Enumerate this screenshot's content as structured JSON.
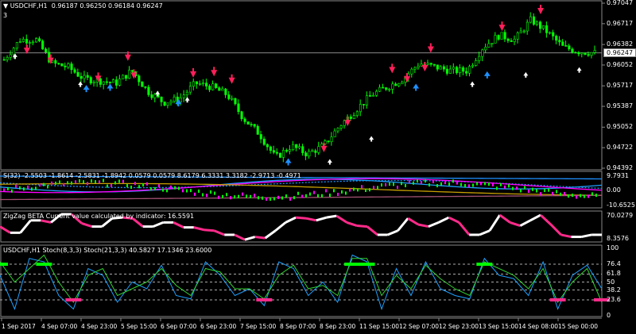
{
  "header": {
    "symbol": "USDCHF,H1",
    "ohlc": "0.96187 0.96250 0.96184 0.96247",
    "sub": "3"
  },
  "colors": {
    "bull": "#00ff00",
    "bear": "#00ff00",
    "up_arrow": "#ffffff",
    "buy_arrow": "#1e90ff",
    "sell_arrow": "#ff1f5a",
    "magenta": "#ff00ff",
    "cyan": "#1ea0ff",
    "zigzag_up": "#ffffff",
    "zigzag_down": "#ff2a8a"
  },
  "chart_data": [
    {
      "type": "candlestick",
      "title": "USDCHF,H1",
      "ylim": [
        0.94392,
        0.97047
      ],
      "y_ticks": [
        "0.97047",
        "0.96717",
        "0.96382",
        "0.96052",
        "0.95717",
        "0.95387",
        "0.95052",
        "0.94722",
        "0.94392"
      ],
      "current_price": "0.96247",
      "close_path": [
        0.9614,
        0.9646,
        0.9646,
        0.9608,
        0.9602,
        0.9583,
        0.958,
        0.9576,
        0.9596,
        0.9563,
        0.9545,
        0.9551,
        0.9576,
        0.957,
        0.9557,
        0.9519,
        0.9494,
        0.9456,
        0.9475,
        0.9462,
        0.9475,
        0.9507,
        0.9532,
        0.9557,
        0.957,
        0.9583,
        0.9608,
        0.9602,
        0.9596,
        0.9596,
        0.9634,
        0.9653,
        0.9646,
        0.9678,
        0.9659,
        0.9634,
        0.9627,
        0.96247
      ],
      "arrows": [
        {
          "i": 0.02,
          "p": 0.962,
          "kind": "up"
        },
        {
          "i": 0.04,
          "p": 0.9628,
          "kind": "sell"
        },
        {
          "i": 0.08,
          "p": 0.9612,
          "kind": "sell"
        },
        {
          "i": 0.14,
          "p": 0.9568,
          "kind": "buy"
        },
        {
          "i": 0.16,
          "p": 0.9583,
          "kind": "sell"
        },
        {
          "i": 0.13,
          "p": 0.9575,
          "kind": "up"
        },
        {
          "i": 0.18,
          "p": 0.957,
          "kind": "buy"
        },
        {
          "i": 0.21,
          "p": 0.9617,
          "kind": "sell"
        },
        {
          "i": 0.22,
          "p": 0.9588,
          "kind": "sell"
        },
        {
          "i": 0.26,
          "p": 0.956,
          "kind": "up"
        },
        {
          "i": 0.295,
          "p": 0.9545,
          "kind": "buy"
        },
        {
          "i": 0.31,
          "p": 0.955,
          "kind": "up"
        },
        {
          "i": 0.32,
          "p": 0.959,
          "kind": "sell"
        },
        {
          "i": 0.355,
          "p": 0.9592,
          "kind": "sell"
        },
        {
          "i": 0.385,
          "p": 0.958,
          "kind": "sell"
        },
        {
          "i": 0.48,
          "p": 0.945,
          "kind": "buy"
        },
        {
          "i": 0.54,
          "p": 0.947,
          "kind": "sell"
        },
        {
          "i": 0.55,
          "p": 0.945,
          "kind": "up"
        },
        {
          "i": 0.58,
          "p": 0.9512,
          "kind": "sell"
        },
        {
          "i": 0.62,
          "p": 0.9487,
          "kind": "up"
        },
        {
          "i": 0.655,
          "p": 0.9597,
          "kind": "sell"
        },
        {
          "i": 0.68,
          "p": 0.9582,
          "kind": "sell"
        },
        {
          "i": 0.695,
          "p": 0.957,
          "kind": "buy"
        },
        {
          "i": 0.72,
          "p": 0.963,
          "kind": "sell"
        },
        {
          "i": 0.71,
          "p": 0.96,
          "kind": "sell"
        },
        {
          "i": 0.79,
          "p": 0.9575,
          "kind": "up"
        },
        {
          "i": 0.815,
          "p": 0.959,
          "kind": "buy"
        },
        {
          "i": 0.84,
          "p": 0.9665,
          "kind": "sell"
        },
        {
          "i": 0.88,
          "p": 0.959,
          "kind": "up"
        },
        {
          "i": 0.905,
          "p": 0.9692,
          "kind": "sell"
        },
        {
          "i": 0.97,
          "p": 0.9598,
          "kind": "up"
        }
      ]
    },
    {
      "type": "line",
      "title": "S(32)",
      "legend_values": "-2.5503 -1.8614 -2.5831 -1.8942 0.0579 0.0579 8.6179 6.3331 3.3182 -2.9713 -0.4971",
      "label": "S(32) -2.5503 -1.8614 -2.5831 -1.8942 0.0579 0.0579 8.6179 6.3331 3.3182 -2.9713 -0.4971",
      "ylim": [
        -10.6525,
        9.7931
      ],
      "y_ticks": [
        "9.7931",
        "0.00",
        "-10.6525"
      ]
    },
    {
      "type": "line",
      "title": "ZigZag BETA",
      "label": "ZigZag BETA  Current value calculated by indicator: 16.5591",
      "ylim": [
        8.3576,
        70.0279
      ],
      "y_ticks": [
        "70.0279",
        "8.3576"
      ],
      "values": [
        40,
        25,
        25,
        55,
        55,
        50,
        70,
        70,
        48,
        40,
        40,
        60,
        62,
        60,
        40,
        40,
        50,
        50,
        38,
        38,
        32,
        30,
        20,
        20,
        8,
        15,
        12,
        30,
        50,
        62,
        60,
        55,
        62,
        66,
        50,
        42,
        40,
        20,
        20,
        30,
        60,
        45,
        40,
        50,
        62,
        50,
        20,
        20,
        30,
        68,
        50,
        42,
        55,
        68,
        45,
        20,
        15,
        15,
        20,
        20
      ],
      "up_segments_color": "#ffffff",
      "down_segments_color": "#ff2a8a"
    },
    {
      "type": "line",
      "title": "USDCHF,H1 Stoch(8,3,3) Stoch(21,3,3)",
      "label": "USDCHF,H1 Stoch(8,3,3) Stoch(21,3,3) 40.5827 17.1346 23.6000",
      "ylim": [
        0,
        100
      ],
      "y_ticks": [
        "100",
        "76.4",
        "61.8",
        "50",
        "38.2",
        "23.6",
        "0"
      ],
      "series": [
        {
          "name": "Stoch(8,3,3)",
          "color": "#1ea0ff",
          "values": [
            60,
            10,
            85,
            80,
            30,
            10,
            70,
            60,
            20,
            50,
            40,
            75,
            30,
            25,
            80,
            60,
            30,
            40,
            15,
            80,
            70,
            30,
            50,
            20,
            90,
            80,
            10,
            70,
            30,
            80,
            40,
            30,
            25,
            85,
            60,
            55,
            30,
            80,
            10,
            60,
            75,
            40
          ]
        },
        {
          "name": "Stoch(21,3,3)",
          "color": "#32d232",
          "values": [
            80,
            50,
            70,
            90,
            50,
            20,
            60,
            70,
            30,
            40,
            50,
            70,
            45,
            30,
            70,
            65,
            40,
            40,
            25,
            60,
            75,
            40,
            45,
            30,
            85,
            85,
            30,
            60,
            40,
            75,
            55,
            40,
            30,
            80,
            70,
            60,
            40,
            70,
            20,
            50,
            70,
            20
          ]
        }
      ],
      "signal_levels": [
        76.4,
        23.6
      ]
    }
  ],
  "time_axis": [
    "1 Sep 2017",
    "4 Sep 07:00",
    "4 Sep 23:00",
    "5 Sep 15:00",
    "6 Sep 07:00",
    "6 Sep 23:00",
    "7 Sep 15:00",
    "8 Sep 07:00",
    "8 Sep 23:00",
    "11 Sep 15:00",
    "12 Sep 07:00",
    "12 Sep 23:00",
    "13 Sep 15:00",
    "14 Sep 08:00",
    "15 Sep 00:00"
  ]
}
